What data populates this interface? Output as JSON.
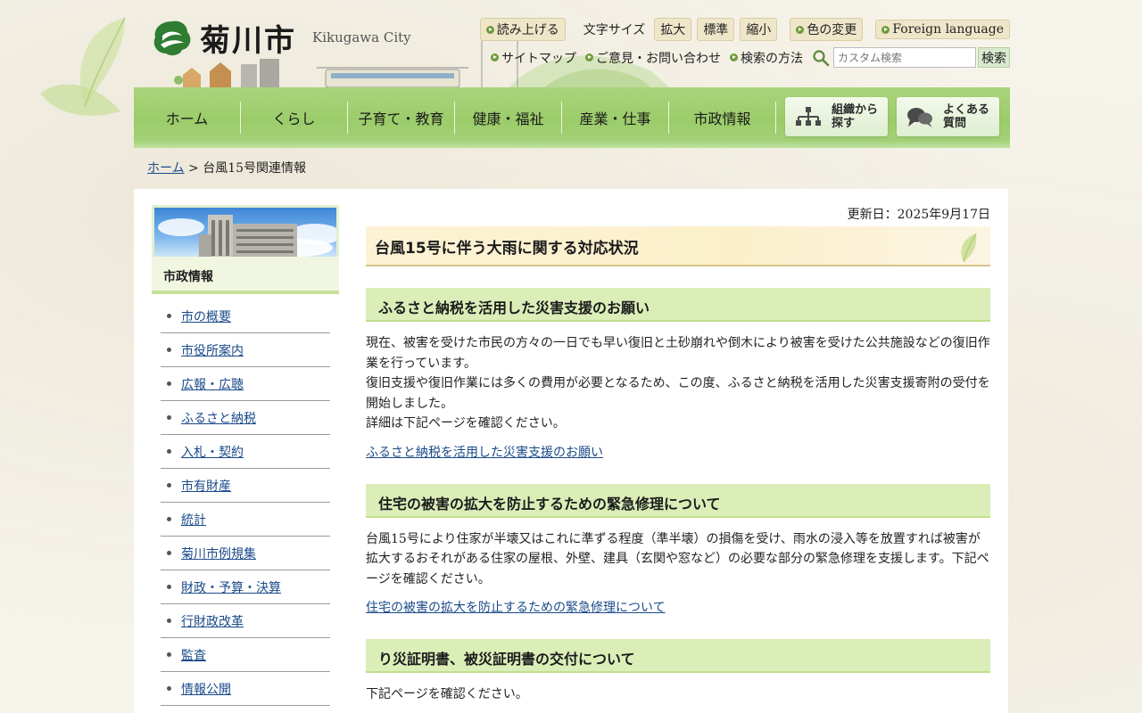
{
  "header": {
    "logo_text": "菊川市",
    "logo_sub": "Kikugawa City",
    "read_aloud": "読み上げる",
    "font_size_label": "文字サイズ",
    "font_larger": "拡大",
    "font_standard": "標準",
    "font_smaller": "縮小",
    "color_change": "色の変更",
    "foreign_language": "Foreign language",
    "sitemap": "サイトマップ",
    "contact": "ご意見・お問い合わせ",
    "search_method": "検索の方法",
    "search_placeholder": "カスタム検索",
    "search_button": "検索"
  },
  "gnav": {
    "items": [
      "ホーム",
      "くらし",
      "子育て・教育",
      "健康・福祉",
      "産業・仕事",
      "市政情報"
    ],
    "org_search": [
      "組織から",
      "探す"
    ],
    "faq": [
      "よくある",
      "質問"
    ]
  },
  "breadcrumb": {
    "home": "ホーム",
    "separator": ">",
    "current": "台風15号関連情報"
  },
  "sidebar": {
    "title": "市政情報",
    "items": [
      "市の概要",
      "市役所案内",
      "広報・広聴",
      "ふるさと納税",
      "入札・契約",
      "市有財産",
      "統計",
      "菊川市例規集",
      "財政・予算・決算",
      "行財政改革",
      "監査",
      "情報公開"
    ]
  },
  "main": {
    "updated": "更新日：2025年9月17日",
    "title": "台風15号に伴う大雨に関する対応状況",
    "sections": [
      {
        "heading": "ふるさと納税を活用した災害支援のお願い",
        "paragraphs": [
          "現在、被害を受けた市民の方々の一日でも早い復旧と土砂崩れや倒木により被害を受けた公共施設などの復旧作業を行っています。",
          "復旧支援や復旧作業には多くの費用が必要となるため、この度、ふるさと納税を活用した災害支援寄附の受付を開始しました。",
          "詳細は下記ページを確認ください。"
        ],
        "link": "ふるさと納税を活用した災害支援のお願い"
      },
      {
        "heading": "住宅の被害の拡大を防止するための緊急修理について",
        "paragraphs": [
          "台風15号により住家が半壊又はこれに準ずる程度（準半壊）の損傷を受け、雨水の浸入等を放置すれば被害が拡大するおそれがある住家の屋根、外壁、建具（玄関や窓など）の必要な部分の緊急修理を支援します。下記ページを確認ください。"
        ],
        "link": "住宅の被害の拡大を防止するための緊急修理について"
      },
      {
        "heading": "り災証明書、被災証明書の交付について",
        "paragraphs": [
          "下記ページを確認ください。"
        ]
      }
    ]
  },
  "colors": {
    "nav_green": "#9ccc6a",
    "heading_green": "#dbeeb8",
    "title_cream": "#fdf3d4",
    "link": "#1a4a8a"
  }
}
